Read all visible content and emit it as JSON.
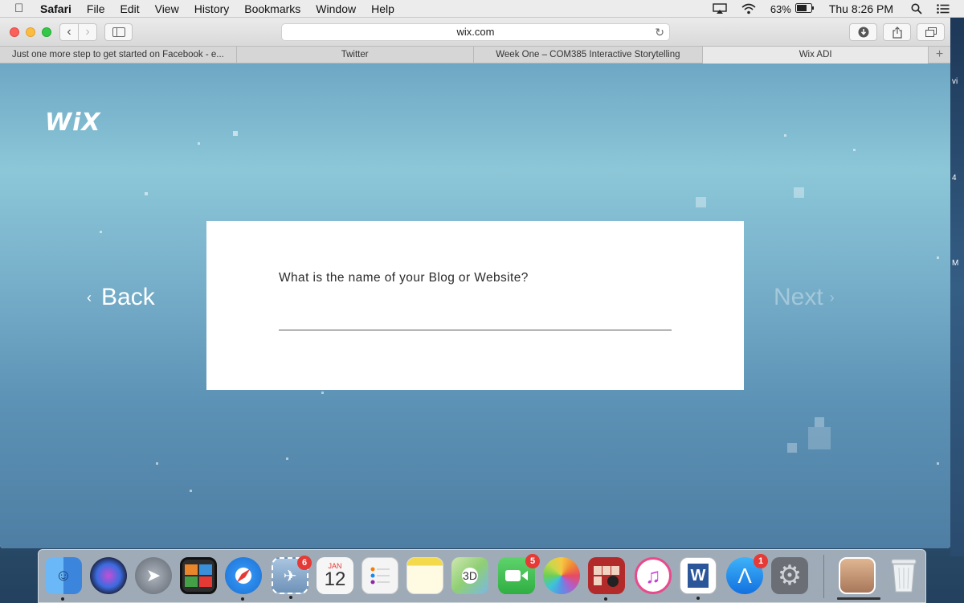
{
  "menubar": {
    "apple_icon": "apple-icon",
    "items": [
      "Safari",
      "File",
      "Edit",
      "View",
      "History",
      "Bookmarks",
      "Window",
      "Help"
    ],
    "battery": "63%",
    "clock": "Thu 8:26 PM"
  },
  "browser": {
    "address": "wix.com",
    "tabs": [
      {
        "label": "Just one more step to get started on Facebook - e..."
      },
      {
        "label": "Twitter"
      },
      {
        "label": "Week One – COM385 Interactive Storytelling"
      },
      {
        "label": "Wix ADI"
      }
    ],
    "new_tab": "+"
  },
  "page": {
    "logo": "WiX",
    "back_label": "Back",
    "next_label": "Next",
    "question": "What is the name of your Blog or Website?",
    "input_value": ""
  },
  "dock": {
    "apps": [
      {
        "name": "Finder",
        "icon": "finder-icon",
        "color": "#3d8ee8"
      },
      {
        "name": "Siri",
        "icon": "siri-icon",
        "color": "#222a4a"
      },
      {
        "name": "Launchpad",
        "icon": "launchpad-icon",
        "color": "#7d8797"
      },
      {
        "name": "Photo Booth",
        "icon": "photo-booth-icon",
        "color": "#2e2e2e"
      },
      {
        "name": "Safari",
        "icon": "safari-icon",
        "color": "#2a8de8"
      },
      {
        "name": "Mail",
        "icon": "mail-icon",
        "color": "#88a7c7",
        "badge": "6"
      },
      {
        "name": "Calendar",
        "icon": "calendar-icon",
        "color": "#f5f5f5",
        "month": "JAN",
        "day": "12"
      },
      {
        "name": "Reminders",
        "icon": "reminders-icon",
        "color": "#f4f4f4"
      },
      {
        "name": "Notes",
        "icon": "notes-icon",
        "color": "#f8e27a"
      },
      {
        "name": "Maps",
        "icon": "maps-icon",
        "color": "#8fd17a"
      },
      {
        "name": "FaceTime",
        "icon": "facetime-icon",
        "color": "#3ebd4f",
        "badge": "5"
      },
      {
        "name": "Photos",
        "icon": "photos-icon",
        "color": "#f4f4f4"
      },
      {
        "name": "Photo Booth Strip",
        "icon": "photo-strip-icon",
        "color": "#b22a2a"
      },
      {
        "name": "iTunes",
        "icon": "itunes-icon",
        "color": "#f4f4f4"
      },
      {
        "name": "Word",
        "icon": "word-icon",
        "color": "#2b579a"
      },
      {
        "name": "App Store",
        "icon": "app-store-icon",
        "color": "#1d8df0",
        "badge": "1"
      },
      {
        "name": "System Preferences",
        "icon": "system-preferences-icon",
        "color": "#6b6f75"
      },
      {
        "name": "Downloads",
        "icon": "downloads-stack-icon",
        "color": "#c9a07a"
      },
      {
        "name": "Trash",
        "icon": "trash-icon",
        "color": "#dfe3e6"
      }
    ]
  },
  "edge_labels": [
    "vi",
    "4",
    "M"
  ]
}
